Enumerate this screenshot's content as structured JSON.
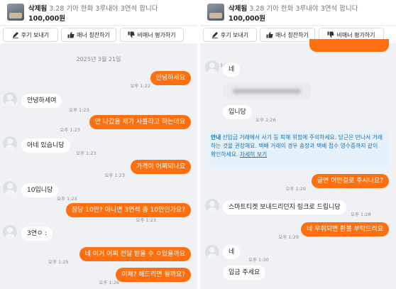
{
  "item": {
    "seller": "삭제됨",
    "title": "3.28 기아 한화 3루내야 3연석 팝니다",
    "price": "100,000원"
  },
  "actions": {
    "review": "후기 보내기",
    "praise": "매너 칭찬하기",
    "report": "비매너 평가하기"
  },
  "left": {
    "date": "2025년 3월 21일",
    "messages": [
      {
        "text": "안녕하세요",
        "time": "오후 1:22"
      },
      {
        "text": "안녕하세여",
        "time": "오후 1:23"
      },
      {
        "text": "안 나갔음 제가 사볼라고 하는데요",
        "time": "오후 1:23"
      },
      {
        "text": "아네 있습니당",
        "time": "오후 1:23"
      },
      {
        "text": "가격이 어찌되나요",
        "time": "오후 1:23"
      },
      {
        "text": "10입니당",
        "time": "오후 1:23"
      },
      {
        "text": "장당 10만? 아니면 3연석 총 10만인가요?",
        "time": "오후 1:23"
      },
      {
        "text": "3연ㅇ :",
        "time": "오후 1:25"
      },
      {
        "text": "네 이거 어찌 전달 받을 수 ㅇ있을까요",
        "time": "오후 1:25"
      },
      {
        "text": "이체? 해드리면 될까요?",
        "time": "오후 1:26"
      }
    ]
  },
  "right": {
    "messages": [
      {
        "text": "네",
        "time": ""
      },
      {
        "text": "입니당",
        "time": "오후 1:26"
      },
      {
        "text": "글면 어떤걸로 주시나요?",
        "time": "오후 1:26"
      },
      {
        "text": "스마트티켓 보내드리던지 링크로 드립니당",
        "time": "오후 1:28"
      },
      {
        "text": "네 우취되면 환불 부탁드려요",
        "time": "오후 1:29"
      },
      {
        "text": "네",
        "time": "오후 1:30"
      },
      {
        "text": "입금 주세요",
        "time": ""
      }
    ],
    "top_time": "오후 1:22",
    "notice": {
      "title": "안내",
      "body": "선입금 거래에서 사기 등 피해 위험에 주의하세요. 당근은 만나서 거래하는 것을 권장해요. 택배 거래의 경우 송장과 택배 접수 영수증까지 같이 확인하세요.",
      "link": "자세히 보기"
    }
  },
  "colors": {
    "accent": "#fe6f0f",
    "chat_bg": "#f0f1f4",
    "notice_bg": "#e6f2fb",
    "notice_text": "#1c6fa6"
  },
  "icons": [
    "pencil-icon",
    "thumbs-up-icon",
    "thumbs-down-icon",
    "profile-avatar-icon"
  ]
}
